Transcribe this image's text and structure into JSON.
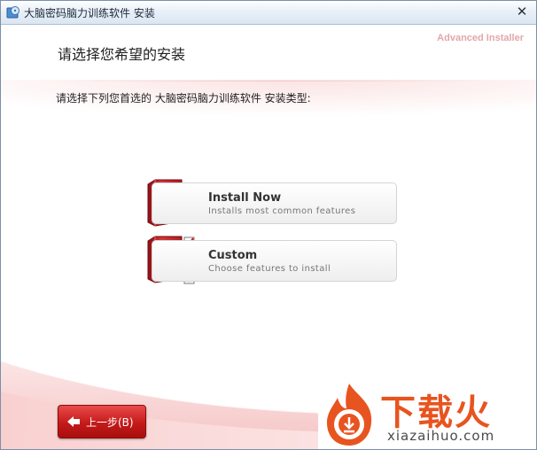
{
  "window": {
    "title": "大脑密码脑力训练软件 安装",
    "close_glyph": "✕"
  },
  "header": {
    "title": "请选择您希望的安装",
    "brand": "Advanced Installer"
  },
  "main": {
    "prompt": "请选择下列您首选的 大脑密码脑力训练软件 安装类型:",
    "options": [
      {
        "title": "Install Now",
        "subtitle": "Installs most common features",
        "icon": "cd-box-icon"
      },
      {
        "title": "Custom",
        "subtitle": "Choose features to install",
        "icon": "cd-box-checklist-icon"
      }
    ]
  },
  "footer": {
    "back_label": "上一步(B)"
  },
  "watermark": {
    "text": "下载火",
    "url": "xiazaihuo.com"
  },
  "colors": {
    "accent_red": "#c51a1a",
    "brand_text": "#e3a6a9",
    "watermark_orange": "#e8541f"
  }
}
